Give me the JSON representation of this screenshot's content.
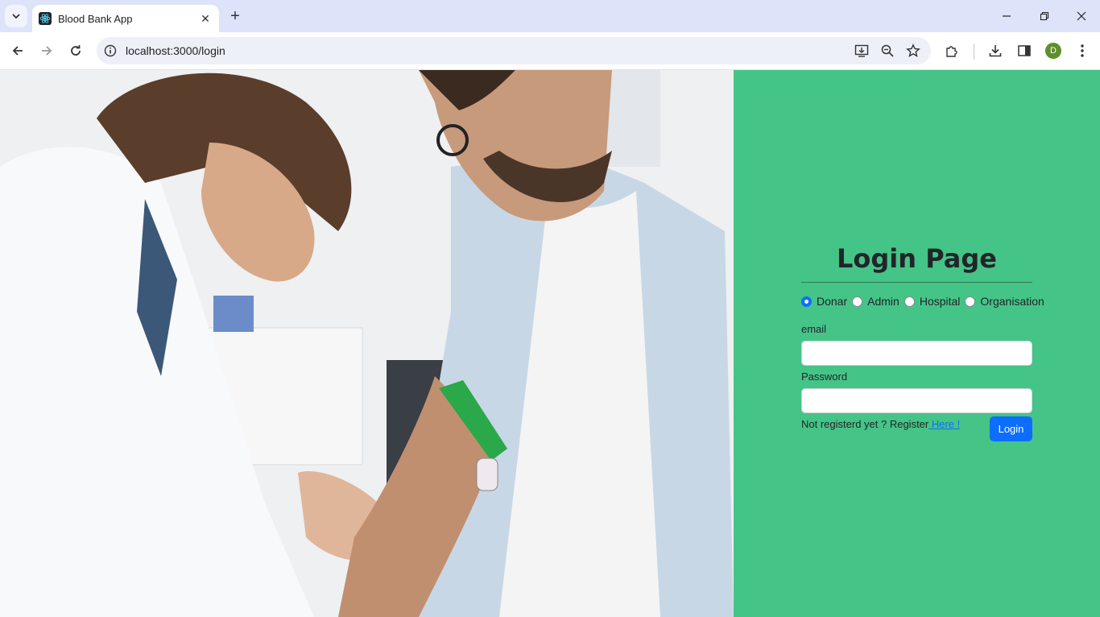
{
  "browser": {
    "tab_title": "Blood Bank App",
    "url": "localhost:3000/login",
    "profile_initial": "D"
  },
  "login": {
    "title": "Login Page",
    "roles": [
      {
        "label": "Donar",
        "checked": true
      },
      {
        "label": "Admin",
        "checked": false
      },
      {
        "label": "Hospital",
        "checked": false
      },
      {
        "label": "Organisation",
        "checked": false
      }
    ],
    "email_label": "email",
    "email_value": "",
    "password_label": "Password",
    "password_value": "",
    "register_prefix": "Not registerd yet ? Register",
    "register_link": " Here !",
    "login_button": "Login"
  },
  "colors": {
    "panel_bg": "#45c487",
    "accent": "#0d6efd"
  }
}
